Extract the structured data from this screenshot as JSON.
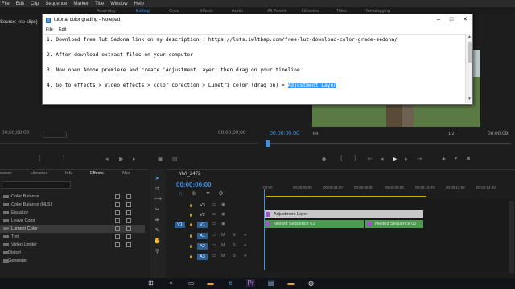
{
  "premiere": {
    "menu": [
      "File",
      "Edit",
      "Clip",
      "Sequence",
      "Marker",
      "Title",
      "Window",
      "Help"
    ],
    "workspace_tabs": [
      "Assembly",
      "Editing",
      "Color",
      "Effects",
      "Audio",
      "All Panels",
      "Libraries",
      "Titles",
      "Metalogging"
    ],
    "source_tab": "Source: (no clips)",
    "source_tc_left": "00;00;00;00",
    "source_tc_right": "00;00;00;00",
    "program_tc": "00:00:00:00",
    "program_fit": "Fit",
    "program_resolution": "1/2",
    "program_duration": "00:00:09:"
  },
  "effects_panel": {
    "tabs": [
      "owser",
      "Libraries",
      "Info",
      "Effects",
      "Mar"
    ],
    "items": [
      {
        "label": "Color Balance",
        "type": "effect",
        "selected": false
      },
      {
        "label": "Color Balance (HLS)",
        "type": "effect",
        "selected": false
      },
      {
        "label": "Equalize",
        "type": "effect",
        "selected": false
      },
      {
        "label": "Leave Color",
        "type": "effect",
        "selected": false
      },
      {
        "label": "Lumetri Color",
        "type": "effect",
        "selected": true
      },
      {
        "label": "Tint",
        "type": "effect",
        "selected": false
      },
      {
        "label": "Video Limiter",
        "type": "effect",
        "selected": false
      },
      {
        "label": "Distort",
        "type": "folder",
        "selected": false
      },
      {
        "label": "Generate",
        "type": "folder",
        "selected": false
      }
    ]
  },
  "timeline": {
    "sequence_name": "MVI_2472",
    "timecode": "00:00:00:00",
    "ruler_labels": [
      ":00:00",
      "00:00:02:00",
      "00:00:04:00",
      "00:00:06:00",
      "00:00:08:00",
      "00:00:10:00",
      "00:00:12:00",
      "00:00:14:00"
    ],
    "tracks": [
      {
        "src": "",
        "label": "V3",
        "on": false
      },
      {
        "src": "",
        "label": "V2",
        "on": false
      },
      {
        "src": "V1",
        "label": "V1",
        "on": true
      },
      {
        "src": "",
        "label": "A1",
        "on": true
      },
      {
        "src": "",
        "label": "A2",
        "on": true
      },
      {
        "src": "",
        "label": "A3",
        "on": true
      }
    ],
    "clips": {
      "adjustment": "Adjustment Layer",
      "nested1": "Nested Sequence 01",
      "nested2": "Nested Sequence 02"
    }
  },
  "notepad": {
    "title": "tutorial color grading - Notepad",
    "menu": [
      "File",
      "Edit"
    ],
    "lines": [
      "1. Download free lut Sedona link on my description : https://luts.iwltbap.com/free-lut-download-color-grade-sedona/",
      "2. After download extract files on your computer",
      "3. Now open Adobe premiere and create 'Adjustment Layer' then drag on your timeline",
      "4. Go to effects > Video effects > color corection > Lumetri color (drag on) > "
    ],
    "selected_text": "Adjustment Layer"
  }
}
